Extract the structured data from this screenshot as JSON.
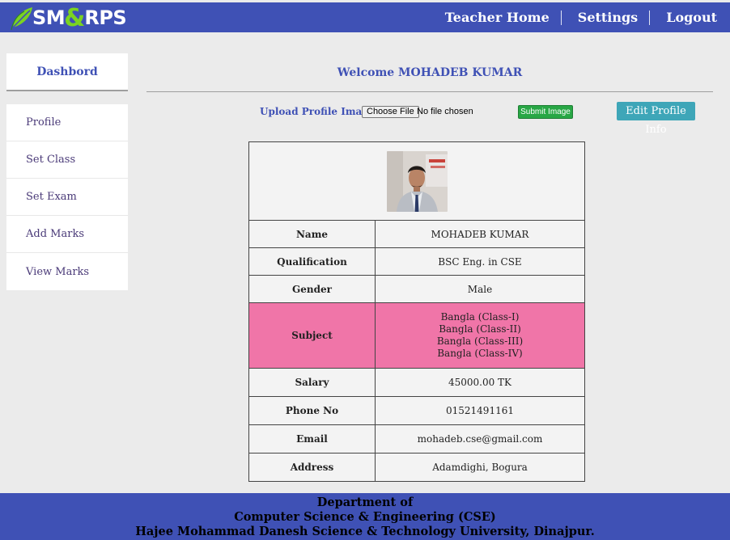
{
  "app": {
    "logo_part1": "SM",
    "logo_amp": "&",
    "logo_part2": "RPS"
  },
  "nav": {
    "teacher_home": "Teacher Home",
    "settings": "Settings",
    "logout": "Logout"
  },
  "sidebar": {
    "heading": "Dashbord",
    "items": [
      {
        "label": "Profile"
      },
      {
        "label": "Set Class"
      },
      {
        "label": "Set Exam"
      },
      {
        "label": "Add Marks"
      },
      {
        "label": "View Marks"
      }
    ]
  },
  "main": {
    "welcome": "Welcome MOHADEB KUMAR",
    "upload_label": "Upload Profile Image:",
    "required_mark": "*",
    "choose_file_label": "Choose File",
    "file_status": "No file chosen",
    "submit_label": "Submit Image",
    "edit_label": "Edit Profile Info"
  },
  "profile": {
    "name_label": "Name",
    "name": "MOHADEB KUMAR",
    "qualification_label": "Qualification",
    "qualification": "BSC Eng. in CSE",
    "gender_label": "Gender",
    "gender": "Male",
    "subject_label": "Subject",
    "subjects": [
      "Bangla (Class-I)",
      "Bangla (Class-II)",
      "Bangla (Class-III)",
      "Bangla (Class-IV)"
    ],
    "salary_label": "Salary",
    "salary": "45000.00 TK",
    "phone_label": "Phone No",
    "phone": "01521491161",
    "email_label": "Email",
    "email": "mohadeb.cse@gmail.com",
    "address_label": "Address",
    "address": "Adamdighi, Bogura"
  },
  "footer": {
    "line1": "Department of",
    "line2": "Computer Science & Engineering (CSE)",
    "line3": "Hajee Mohammad Danesh Science & Technology University, Dinajpur."
  },
  "colors": {
    "brand_blue": "#3f51b5",
    "logo_green": "#7bd321",
    "submit_green": "#28a745",
    "edit_teal": "#3ea6b8",
    "subject_pink": "#f075a8"
  }
}
